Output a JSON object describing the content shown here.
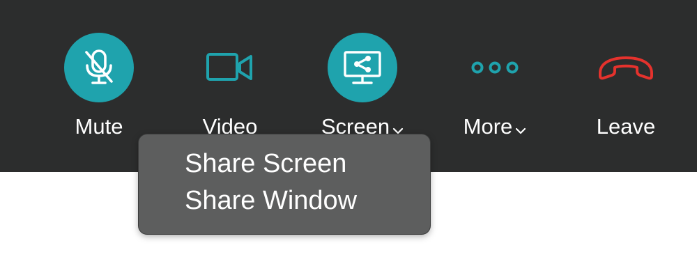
{
  "colors": {
    "toolbar_bg": "#2c2d2d",
    "accent": "#1fa3ad",
    "leave_red": "#e5322d",
    "label_text": "#ffffff",
    "popup_bg": "#5d5e5e"
  },
  "toolbar": {
    "mute": {
      "label": "Mute",
      "icon": "microphone-muted-icon"
    },
    "video": {
      "label": "Video",
      "icon": "video-camera-icon"
    },
    "screen": {
      "label": "Screen",
      "icon": "screen-share-icon",
      "dropdown_icon": "chevron-down-icon"
    },
    "more": {
      "label": "More",
      "icon": "more-dots-icon",
      "dropdown_icon": "chevron-down-icon"
    },
    "leave": {
      "label": "Leave",
      "icon": "phone-hangup-icon"
    }
  },
  "screen_menu": {
    "items": [
      {
        "label": "Share Screen"
      },
      {
        "label": "Share Window"
      }
    ]
  }
}
